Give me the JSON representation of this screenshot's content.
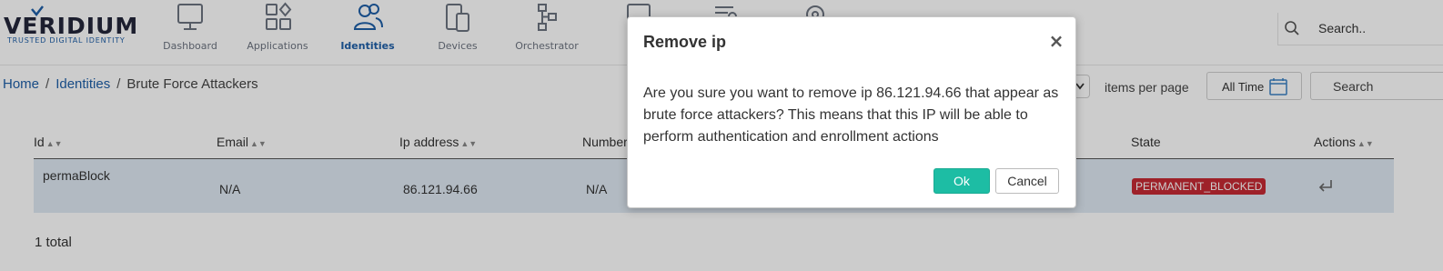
{
  "logo": {
    "main": "VERIDIUM",
    "tagline": "TRUSTED DIGITAL IDENTITY"
  },
  "nav": {
    "items": [
      {
        "label": "Dashboard",
        "icon": "monitor-icon"
      },
      {
        "label": "Applications",
        "icon": "applications-icon"
      },
      {
        "label": "Identities",
        "icon": "users-icon",
        "active": true
      },
      {
        "label": "Devices",
        "icon": "devices-icon"
      },
      {
        "label": "Orchestrator",
        "icon": "orchestrator-icon"
      }
    ]
  },
  "header_search": {
    "placeholder": "Search.."
  },
  "breadcrumb": {
    "home": "Home",
    "section": "Identities",
    "current": "Brute Force Attackers"
  },
  "toolbar": {
    "items_per_page_label": "items per page",
    "time_filter_label": "All Time",
    "search_placeholder": "Search"
  },
  "table": {
    "columns": [
      "Id",
      "Email",
      "Ip address",
      "Number",
      "State",
      "Actions"
    ],
    "rows": [
      {
        "id": "permaBlock",
        "email": "N/A",
        "ip": "86.121.94.66",
        "number": "N/A",
        "state": "PERMANENT_BLOCKED"
      }
    ],
    "total_label": "1 total"
  },
  "modal": {
    "title": "Remove ip",
    "close_symbol": "×",
    "body": "Are you sure you want to remove ip 86.121.94.66 that appear as brute force attackers? This means that this IP will be able to perform authentication and enrollment actions",
    "ok_label": "Ok",
    "cancel_label": "Cancel"
  },
  "colors": {
    "brand_blue": "#1f5fa8",
    "ok_button": "#1dbda4",
    "state_badge": "#c62a34",
    "row_highlight": "#dfe9f3"
  }
}
